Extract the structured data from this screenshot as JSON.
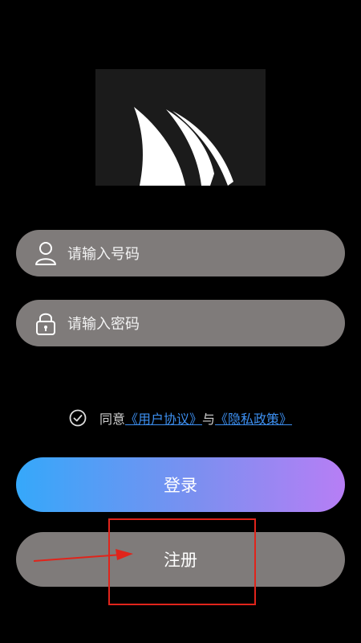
{
  "logo": {
    "icon": "shark-fin-logo-icon"
  },
  "phone_field": {
    "placeholder": "请输入号码",
    "icon": "user-icon"
  },
  "password_field": {
    "placeholder": "请输入密码",
    "icon": "lock-icon"
  },
  "agreement": {
    "prefix": "同意",
    "user_agreement": "《用户协议》",
    "conjunction": "与",
    "privacy_policy": "《隐私政策》",
    "icon": "check-circle-icon"
  },
  "buttons": {
    "login": "登录",
    "register": "注册"
  },
  "annotation": {
    "color": "#e0241b"
  },
  "colors": {
    "link": "#3d8ff0",
    "field_bg": "#7f7b7a",
    "gradient_start": "#35a8fa",
    "gradient_end": "#b77ef5"
  }
}
